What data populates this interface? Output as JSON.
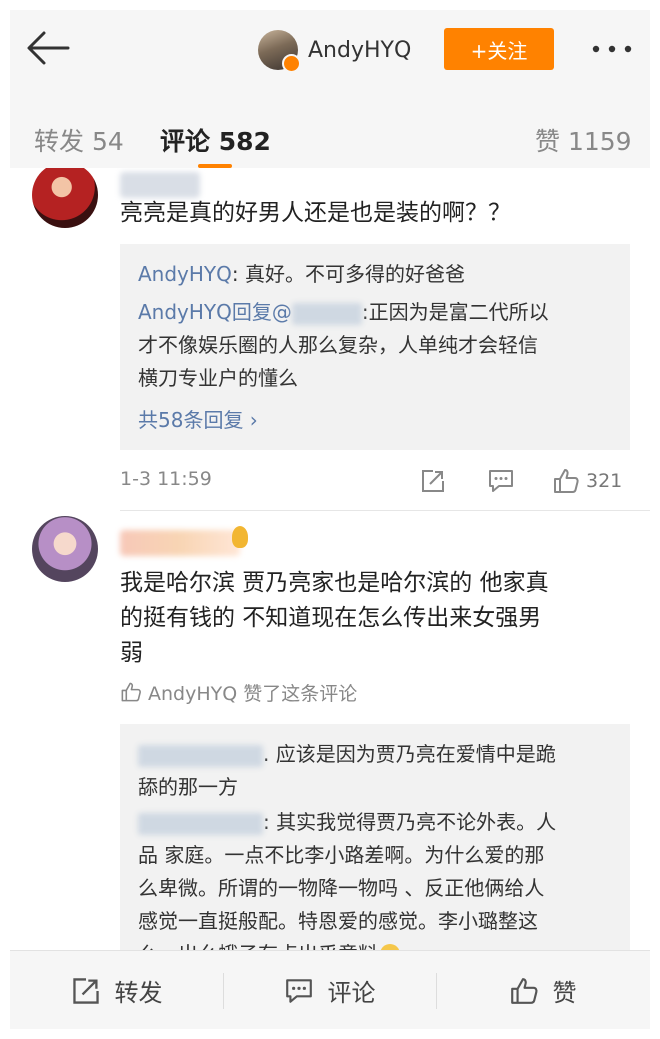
{
  "header": {
    "user_name": "AndyHYQ",
    "follow_label": "+关注"
  },
  "tabs": [
    {
      "label": "转发 54"
    },
    {
      "label": "评论 582"
    },
    {
      "label": "赞 1159"
    }
  ],
  "comments": [
    {
      "text": "亮亮是真的好男人还是也是装的啊？？",
      "replies": [
        {
          "author": "AndyHYQ",
          "text": ": 真好。不可多得的好爸爸"
        },
        {
          "author": "AndyHYQ",
          "prefix": "回复@",
          "lines": [
            ":正因为是富二代所以",
            "才不像娱乐圈的人那么复杂，人单纯才会轻信",
            "横刀专业户的懂么"
          ]
        }
      ],
      "more_replies": "共58条回复 ›",
      "time": "1-3 11:59",
      "like_count": "321"
    },
    {
      "lines": [
        "我是哈尔滨 贾乃亮家也是哈尔滨的 他家真",
        "的挺有钱的 不知道现在怎么传出来女强男",
        "弱"
      ],
      "liked_by": "AndyHYQ 赞了这条评论",
      "replies": [
        {
          "lines": [
            ". 应该是因为贾乃亮在爱情中是跪",
            "舔的那一方"
          ]
        },
        {
          "lines": [
            ": 其实我觉得贾乃亮不论外表。人",
            "品 家庭。一点不比李小路差啊。为什么爱的那",
            "么卑微。所谓的一物降一物吗 、反正他俩给人",
            "感觉一直挺般配。特恩爱的感觉。李小璐整这",
            "么一出幺蛾子有点出乎意料"
          ]
        }
      ]
    }
  ],
  "bottom_bar": {
    "repost": "转发",
    "comment": "评论",
    "like": "赞"
  },
  "colors": {
    "accent": "#ff8200",
    "link": "#5b7aa9"
  },
  "icons": [
    "back-arrow-icon",
    "more-icon",
    "share-icon",
    "comment-icon",
    "thumbs-up-icon"
  ]
}
